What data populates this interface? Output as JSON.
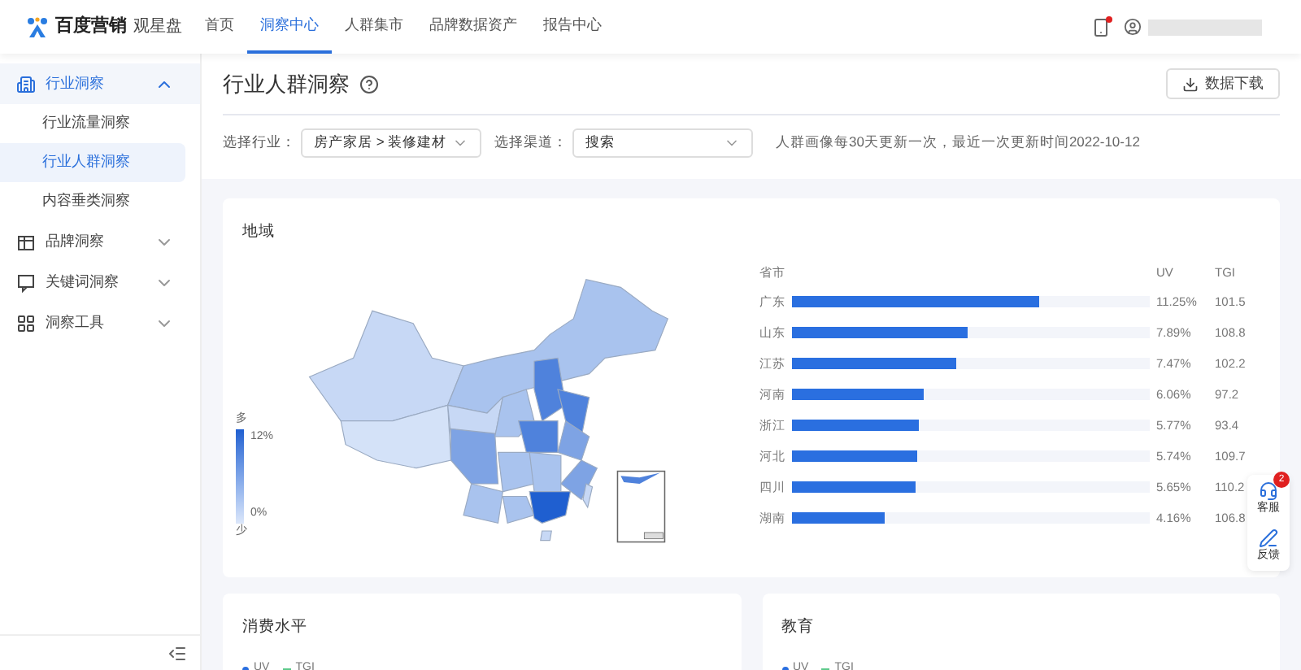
{
  "header": {
    "brand": "百度营销",
    "product": "观星盘",
    "nav": [
      {
        "label": "首页",
        "selected": false
      },
      {
        "label": "洞察中心",
        "selected": true
      },
      {
        "label": "人群集市",
        "selected": false
      },
      {
        "label": "品牌数据资产",
        "selected": false
      },
      {
        "label": "报告中心",
        "selected": false
      }
    ],
    "notification_unread": true
  },
  "sidebar": {
    "items": [
      {
        "label": "行业洞察",
        "expanded": true,
        "children": [
          {
            "label": "行业流量洞察",
            "selected": false
          },
          {
            "label": "行业人群洞察",
            "selected": true
          },
          {
            "label": "内容垂类洞察",
            "selected": false
          }
        ]
      },
      {
        "label": "品牌洞察",
        "expanded": false
      },
      {
        "label": "关键词洞察",
        "expanded": false
      },
      {
        "label": "洞察工具",
        "expanded": false
      }
    ]
  },
  "page": {
    "title": "行业人群洞察",
    "download_button": "数据下载",
    "filters": [
      {
        "label": "选择行业：",
        "value": "房产家居 > 装修建材"
      },
      {
        "label": "选择渠道：",
        "value": "搜索"
      }
    ],
    "update_note": "人群画像每30天更新一次，最近一次更新时间2022-10-12"
  },
  "region_card": {
    "title": "地域",
    "legend": {
      "high": "多",
      "max": "12%",
      "min": "0%",
      "low": "少"
    },
    "columns": [
      "省市",
      "UV",
      "TGI"
    ],
    "rows": [
      {
        "name": "广东",
        "level": 0.69,
        "uv": "11.25%",
        "tgi": "101.5"
      },
      {
        "name": "山东",
        "level": 0.49,
        "uv": "7.89%",
        "tgi": "108.8"
      },
      {
        "name": "江苏",
        "level": 0.46,
        "uv": "7.47%",
        "tgi": "102.2"
      },
      {
        "name": "河南",
        "level": 0.37,
        "uv": "6.06%",
        "tgi": "97.2"
      },
      {
        "name": "浙江",
        "level": 0.355,
        "uv": "5.77%",
        "tgi": "93.4"
      },
      {
        "name": "河北",
        "level": 0.35,
        "uv": "5.74%",
        "tgi": "109.7"
      },
      {
        "name": "四川",
        "level": 0.345,
        "uv": "5.65%",
        "tgi": "110.2"
      },
      {
        "name": "湖南",
        "level": 0.26,
        "uv": "4.16%",
        "tgi": "106.8"
      }
    ]
  },
  "bottom_cards": [
    {
      "title": "消费水平",
      "legend": [
        "UV",
        "TGI"
      ]
    },
    {
      "title": "教育",
      "legend": [
        "UV",
        "TGI"
      ]
    }
  ],
  "float_tools": [
    {
      "kind": "service",
      "label": "客服",
      "badge": "2"
    },
    {
      "kind": "feedback",
      "label": "反馈"
    }
  ]
}
